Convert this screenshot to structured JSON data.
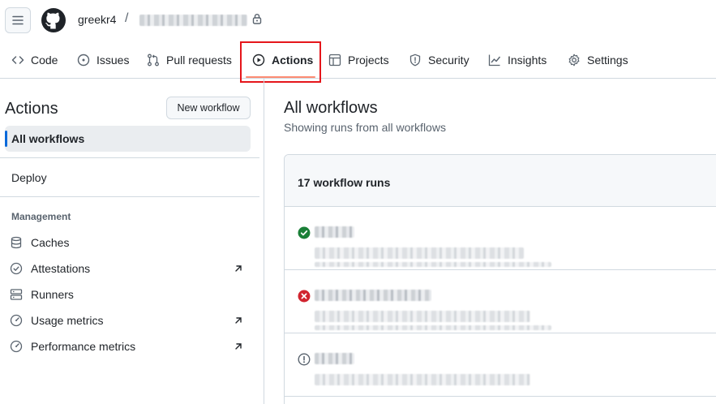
{
  "header": {
    "owner": "greekr4",
    "separator": "/"
  },
  "tabs": [
    {
      "label": "Code",
      "icon": "code-icon"
    },
    {
      "label": "Issues",
      "icon": "issue-opened-icon"
    },
    {
      "label": "Pull requests",
      "icon": "git-pull-request-icon"
    },
    {
      "label": "Actions",
      "icon": "play-icon",
      "active": true
    },
    {
      "label": "Projects",
      "icon": "table-icon"
    },
    {
      "label": "Security",
      "icon": "shield-icon"
    },
    {
      "label": "Insights",
      "icon": "graph-icon"
    },
    {
      "label": "Settings",
      "icon": "gear-icon"
    }
  ],
  "sidebar": {
    "title": "Actions",
    "new_workflow_label": "New workflow",
    "all_workflows_label": "All workflows",
    "deploy_label": "Deploy",
    "management_heading": "Management",
    "items": [
      {
        "label": "Caches",
        "icon": "database-icon",
        "external": false
      },
      {
        "label": "Attestations",
        "icon": "verified-icon",
        "external": true
      },
      {
        "label": "Runners",
        "icon": "server-icon",
        "external": false
      },
      {
        "label": "Usage metrics",
        "icon": "meter-icon",
        "external": true
      },
      {
        "label": "Performance metrics",
        "icon": "meter-icon",
        "external": true
      }
    ]
  },
  "main": {
    "title": "All workflows",
    "subtitle": "Showing runs from all workflows",
    "runs_count_label": "17 workflow runs",
    "runs": [
      {
        "status": "success",
        "status_color": "#1a7f37"
      },
      {
        "status": "failure",
        "status_color": "#d1242f"
      },
      {
        "status": "cancelled",
        "status_color": "#59636e"
      }
    ]
  },
  "colors": {
    "accent_underline": "#fd8c73",
    "selected_bar": "#0969da",
    "highlight_box": "#e5161b"
  }
}
